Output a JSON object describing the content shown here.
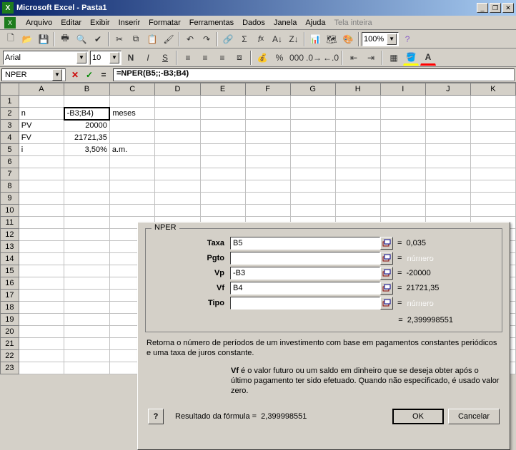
{
  "window": {
    "title": "Microsoft Excel - Pasta1"
  },
  "menu": {
    "file": "Arquivo",
    "edit": "Editar",
    "view": "Exibir",
    "insert": "Inserir",
    "format": "Formatar",
    "tools": "Ferramentas",
    "data": "Dados",
    "window": "Janela",
    "help": "Ajuda",
    "fullscreen": "Tela inteira"
  },
  "toolbar": {
    "zoom": "100%"
  },
  "format": {
    "font": "Arial",
    "size": "10"
  },
  "formula_bar": {
    "name_box": "NPER",
    "cancel": "✕",
    "ok": "✓",
    "eq": "=",
    "formula": "=NPER(B5;;-B3;B4)"
  },
  "sheet": {
    "columns": [
      "A",
      "B",
      "C",
      "D",
      "E",
      "F",
      "G",
      "H",
      "I",
      "J",
      "K"
    ],
    "rows": 23,
    "cells": {
      "A2": "n",
      "B2": "-B3;B4)",
      "C2": "meses",
      "A3": "PV",
      "B3": "20000",
      "A4": "FV",
      "B4": "21721,35",
      "A5": "i",
      "B5": "3,50%",
      "C5": "a.m."
    }
  },
  "dialog": {
    "fn_name": "NPER",
    "args": [
      {
        "label": "Taxa",
        "input": "B5",
        "value": "0,035",
        "bold": true
      },
      {
        "label": "Pgto",
        "input": "",
        "value": "número",
        "bold": true,
        "placeholder": true
      },
      {
        "label": "Vp",
        "input": "-B3",
        "value": "-20000",
        "bold": true
      },
      {
        "label": "Vf",
        "input": "B4",
        "value": "21721,35",
        "bold": false
      },
      {
        "label": "Tipo",
        "input": "",
        "value": "número",
        "bold": false,
        "placeholder": true
      }
    ],
    "result_eq": "=",
    "result_value": "2,399998551",
    "description": "Retorna o número de períodos de um investimento com base em pagamentos constantes periódicos e uma taxa de juros constante.",
    "param_name": "Vf",
    "param_desc": " é o valor futuro ou um saldo em dinheiro que se deseja obter após o último pagamento ter sido efetuado. Quando não especificado, é usado valor zero.",
    "bottom_result_label": "Resultado da fórmula =",
    "bottom_result_value": "2,399998551",
    "ok_btn": "OK",
    "cancel_btn": "Cancelar",
    "help": "?"
  },
  "chart_data": null
}
